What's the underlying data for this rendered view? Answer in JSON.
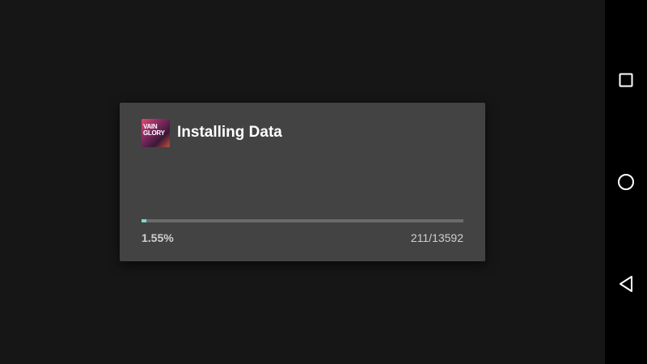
{
  "dialog": {
    "title": "Installing Data",
    "app_icon": {
      "name": "vainglory-app-icon",
      "logo_text": "VAIN GLORY"
    },
    "progress": {
      "fraction": 0.0155,
      "percent_label": "1.55%",
      "count_label": "211/13592"
    }
  },
  "navbar": {
    "buttons": [
      {
        "name": "recents-icon"
      },
      {
        "name": "home-icon"
      },
      {
        "name": "back-icon"
      }
    ]
  },
  "colors": {
    "background": "#161616",
    "dialog": "#434343",
    "progress_fill": "#7ad9cf",
    "progress_track": "#6b6b6b",
    "navbar": "#000000"
  }
}
